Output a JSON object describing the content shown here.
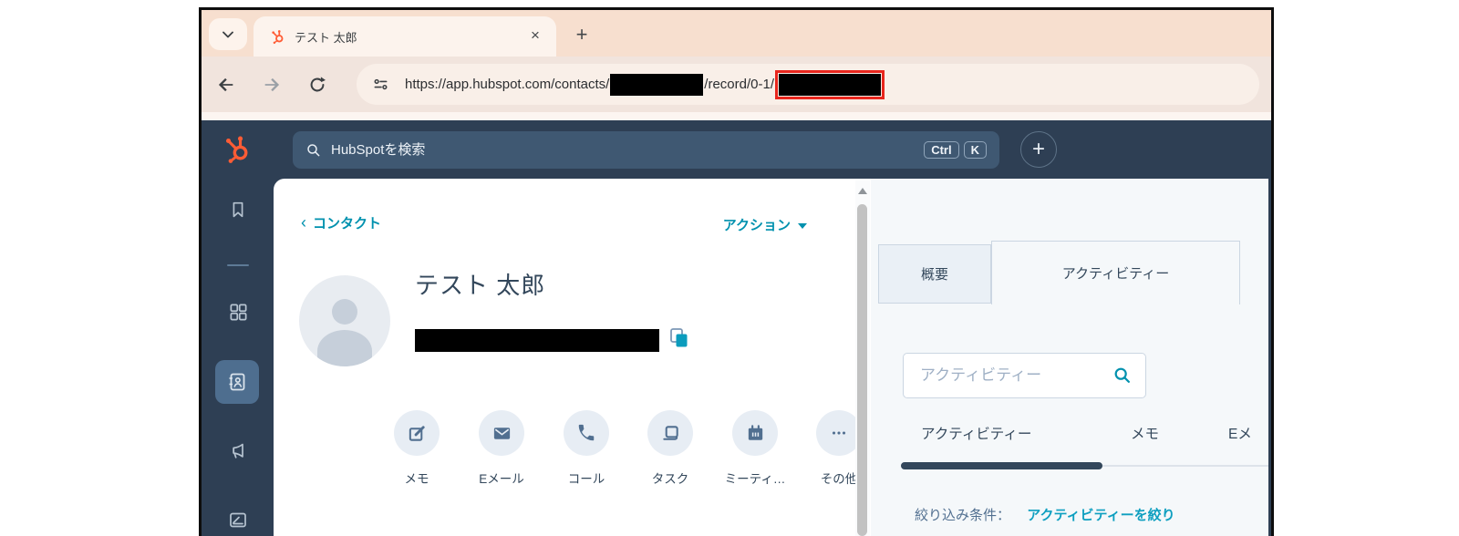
{
  "browser": {
    "tab_title": "テスト 太郎",
    "tab_close": "×",
    "new_tab_label": "+",
    "url": {
      "part1": "https://app.hubspot.com/contacts/",
      "part2": "/record/0-1/"
    }
  },
  "app_header": {
    "search_placeholder": "HubSpotを検索",
    "shortcut_ctrl": "Ctrl",
    "shortcut_k": "K",
    "add_label": "+"
  },
  "sidebar": {
    "items": [
      {
        "icon": "bookmark-icon"
      },
      {
        "icon": "apps-grid-icon"
      },
      {
        "icon": "contacts-book-icon",
        "active": true
      },
      {
        "icon": "megaphone-icon"
      },
      {
        "icon": "content-icon"
      }
    ]
  },
  "left_panel": {
    "breadcrumb_chevron": "‹",
    "breadcrumb": "コンタクト",
    "actions_label": "アクション",
    "contact_name": "テスト 太郎",
    "quick_actions": [
      {
        "label": "メモ",
        "icon": "note-icon"
      },
      {
        "label": "Eメール",
        "icon": "email-icon"
      },
      {
        "label": "コール",
        "icon": "call-icon"
      },
      {
        "label": "タスク",
        "icon": "task-icon"
      },
      {
        "label": "ミーティ…",
        "icon": "meeting-icon"
      },
      {
        "label": "その他",
        "icon": "more-icon"
      }
    ]
  },
  "right_panel": {
    "tabs": [
      {
        "label": "概要",
        "active": false
      },
      {
        "label": "アクティビティー",
        "active": true
      }
    ],
    "search_placeholder": "アクティビティー",
    "subtabs": [
      {
        "label": "アクティビティー",
        "active": true
      },
      {
        "label": "メモ",
        "active": false
      },
      {
        "label": "Eメ",
        "active": false
      }
    ],
    "filter_label": "絞り込み条件：",
    "filter_link": "アクティビティーを絞り"
  },
  "colors": {
    "accent_teal": "#0091ae",
    "hubspot_orange": "#ff5c35",
    "nav_navy": "#2e3f54",
    "redaction_border_red": "#e8261d",
    "tab_strip_peach": "#f7dfcf",
    "panel_gray": "#f5f8fa",
    "text_dark": "#33475b"
  }
}
